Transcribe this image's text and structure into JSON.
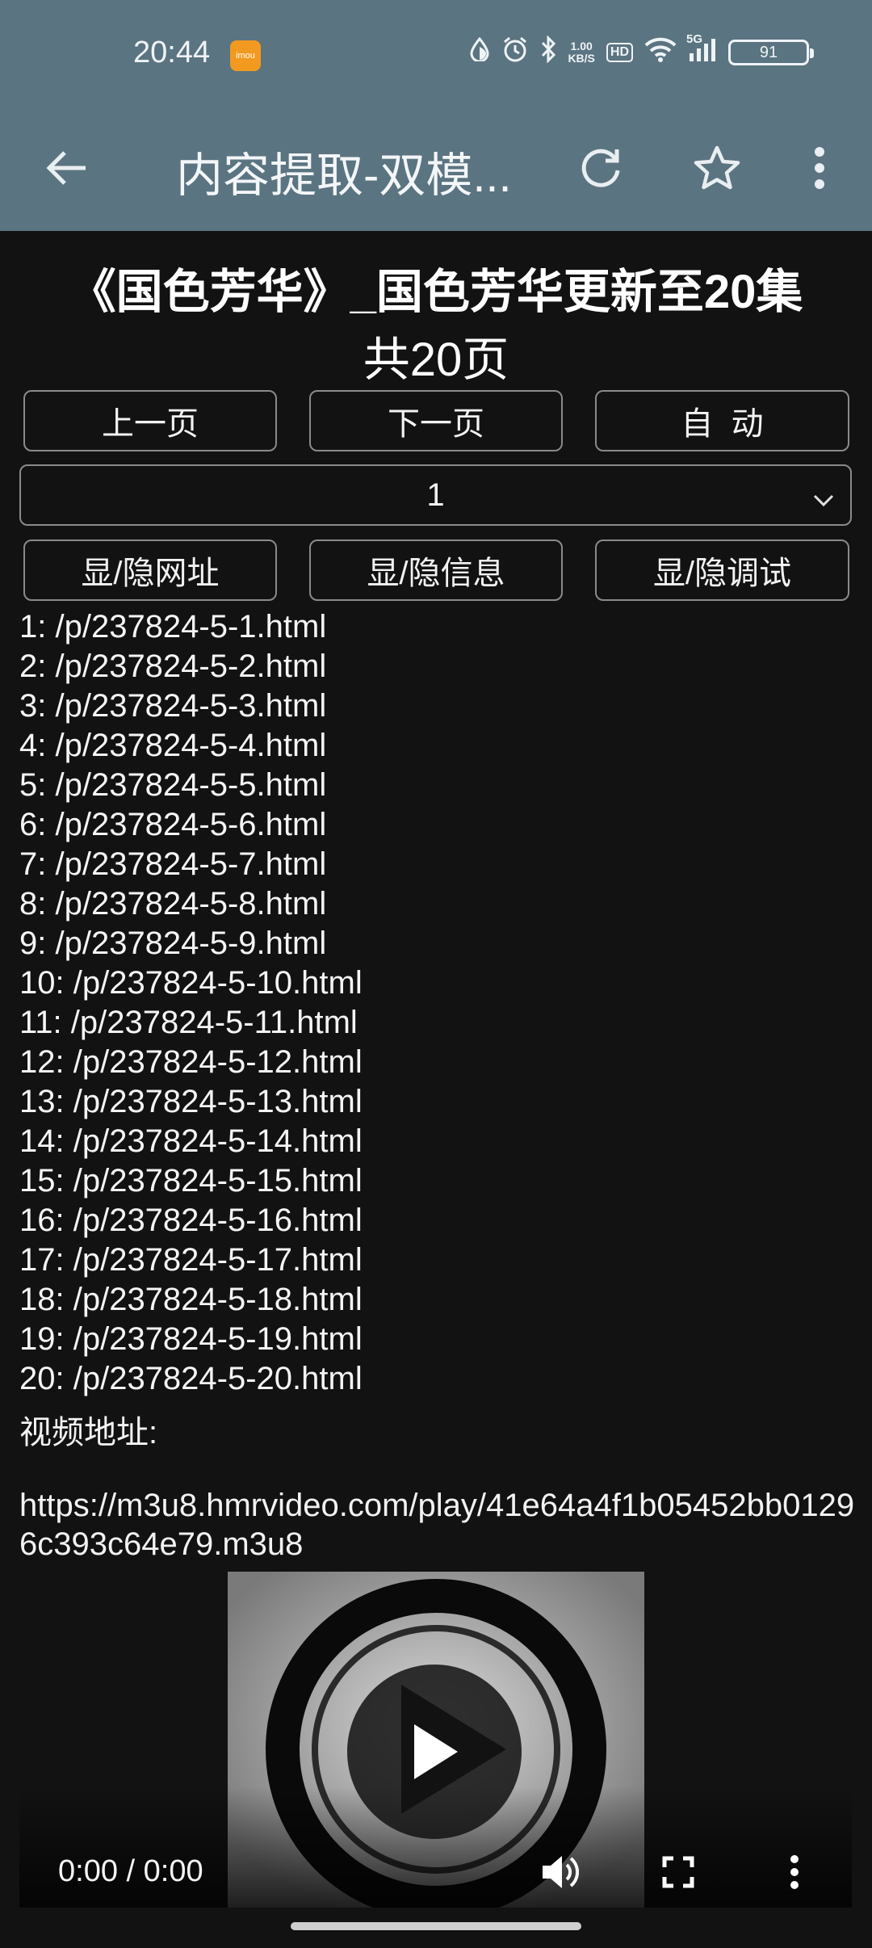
{
  "status_bar": {
    "time": "20:44",
    "app_badge": "imou",
    "net_speed_value": "1.00",
    "net_speed_unit": "KB/S",
    "hd_label": "HD",
    "signal_label": "5G",
    "battery": "91"
  },
  "toolbar": {
    "title": "内容提取-双模..."
  },
  "page": {
    "title": "《国色芳华》_国色芳华更新至20集",
    "page_count": "共20页"
  },
  "buttons": {
    "prev": "上一页",
    "next": "下一页",
    "auto": "自  动",
    "toggle_url": "显/隐网址",
    "toggle_info": "显/隐信息",
    "toggle_debug": "显/隐调试"
  },
  "page_select": {
    "selected": "1"
  },
  "links": [
    "1: /p/237824-5-1.html",
    "2: /p/237824-5-2.html",
    "3: /p/237824-5-3.html",
    "4: /p/237824-5-4.html",
    "5: /p/237824-5-5.html",
    "6: /p/237824-5-6.html",
    "7: /p/237824-5-7.html",
    "8: /p/237824-5-8.html",
    "9: /p/237824-5-9.html",
    "10: /p/237824-5-10.html",
    "11: /p/237824-5-11.html",
    "12: /p/237824-5-12.html",
    "13: /p/237824-5-13.html",
    "14: /p/237824-5-14.html",
    "15: /p/237824-5-15.html",
    "16: /p/237824-5-16.html",
    "17: /p/237824-5-17.html",
    "18: /p/237824-5-18.html",
    "19: /p/237824-5-19.html",
    "20: /p/237824-5-20.html"
  ],
  "video": {
    "label": "视频地址:",
    "url": "https://m3u8.hmrvideo.com/play/41e64a4f1b05452bb01296c393c64e79.m3u8",
    "time_display": "0:00 / 0:00"
  },
  "icons": {
    "back": "back-arrow-icon",
    "refresh": "refresh-icon",
    "star": "star-icon",
    "more": "more-vert-icon",
    "play": "play-icon",
    "volume": "volume-icon",
    "fullscreen": "fullscreen-icon"
  },
  "colors": {
    "toolbar_bg": "#5b7481",
    "page_bg": "#121212",
    "button_border": "#8a8a8a"
  }
}
